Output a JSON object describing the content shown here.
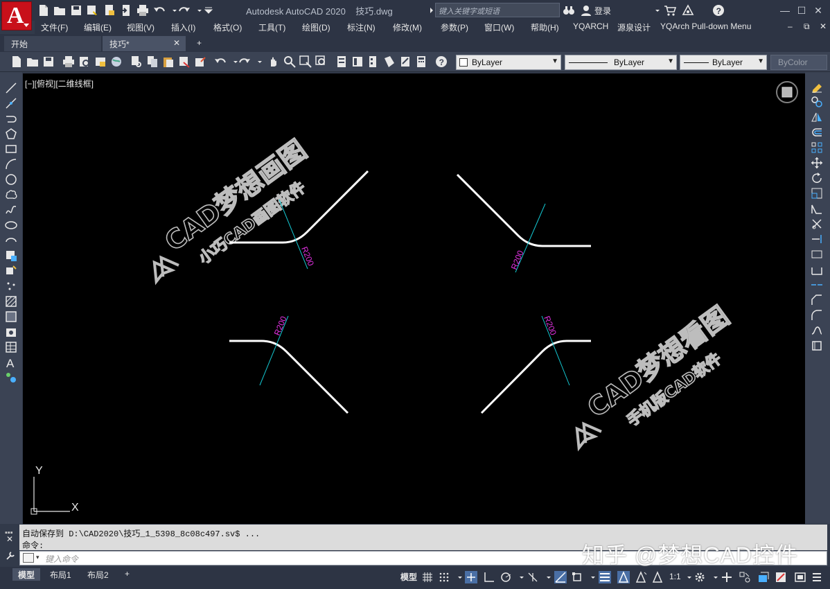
{
  "app": {
    "logo_letter": "A",
    "title": "Autodesk AutoCAD 2020    技巧.dwg",
    "search_placeholder": "键入关键字或短语",
    "login_label": "登录",
    "help_label": "?"
  },
  "menu": [
    "文件(F)",
    "编辑(E)",
    "视图(V)",
    "插入(I)",
    "格式(O)",
    "工具(T)",
    "绘图(D)",
    "标注(N)",
    "修改(M)",
    "参数(P)",
    "窗口(W)",
    "帮助(H)",
    "YQARCH",
    "源泉设计",
    "YQArch Pull-down Menu"
  ],
  "tabs": {
    "start": "开始",
    "document": "技巧*",
    "add": "+",
    "close": "✕"
  },
  "properties": {
    "layer": "ByLayer",
    "linetype": "ByLayer",
    "lineweight": "ByLayer",
    "color": "ByColor"
  },
  "viewport": {
    "label": "[−][俯视][二维线框]",
    "ucs_x": "X",
    "ucs_y": "Y"
  },
  "drawing": {
    "dimension_text": "R200",
    "curve_color": "#ffffff",
    "dim_line_color": "#14c8d2",
    "dim_text_color": "#e030e0"
  },
  "watermarks": {
    "left_line1": "CAD梦想画图",
    "left_line2": "小巧CAD画图软件",
    "right_line1": "CAD梦想看图",
    "right_line2": "手机版CAD软件",
    "bottom": "知乎 @梦想CAD控件"
  },
  "command": {
    "history_line1": "自动保存到 D:\\CAD2020\\技巧_1_5398_8c08c497.sv$ ...",
    "history_line2": "命令:",
    "input_placeholder": "键入命令"
  },
  "status": {
    "layout_model": "模型",
    "layout_1": "布局1",
    "layout_2": "布局2",
    "add": "+",
    "model_label": "模型",
    "scale": "1:1"
  }
}
